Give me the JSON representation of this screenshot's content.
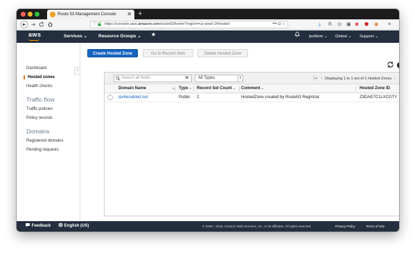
{
  "browser": {
    "tab_title": "Route 53 Management Console",
    "tab_close": "✕",
    "new_tab": "+",
    "url_prefix": "https://console.aws.",
    "url_domain": "amazon.com",
    "url_rest": "/route53/home?region=us-west-1#hosted",
    "url_tools": "•••  ◘  ☆"
  },
  "aws_header": {
    "logo": "aws",
    "services": "Services ⌄",
    "resource_groups": "Resource Groups ⌄",
    "pin_icon": "pin-icon",
    "bell_icon": "bell-icon",
    "account": "ipv6tom ⌄",
    "region": "Global ⌄",
    "support": "Support ⌄"
  },
  "sidebar": {
    "collapse": "‹",
    "items": [
      {
        "label": "Dashboard"
      },
      {
        "label": "Hosted zones"
      },
      {
        "label": "Health checks"
      },
      {
        "label": "Traffic flow"
      },
      {
        "label": "Traffic policies"
      },
      {
        "label": "Policy records"
      },
      {
        "label": "Domains"
      },
      {
        "label": "Registered domains"
      },
      {
        "label": "Pending requests"
      }
    ]
  },
  "toolbar": {
    "create_label": "Create Hosted Zone",
    "goto_label": "Go to Record Sets",
    "delete_label": "Delete Hosted Zone"
  },
  "filter": {
    "search_placeholder": "Search all fields",
    "type_value": "All Types",
    "pager_text": "Displaying 1 to 1 out of 1 Hosted Zones"
  },
  "table": {
    "columns": [
      "Domain Name",
      "Type",
      "Record Set Count",
      "Comment",
      "Hosted Zone ID"
    ],
    "rows": [
      {
        "domain": "ipv6enabled.net.",
        "type": "Public",
        "count": "2",
        "comment": "HostedZone created by Route53 Registrar",
        "zone_id": "Z3DAE7C1LXCGTY"
      }
    ]
  },
  "footer": {
    "feedback": "Feedback",
    "language": "English (US)",
    "copyright": "© 2008 - 2018, Amazon Web Services, Inc. or its affiliates. All rights reserved.",
    "privacy": "Privacy Policy",
    "terms": "Terms of Use"
  },
  "colors": {
    "aws_navy": "#232f3e",
    "aws_orange": "#ff9900",
    "primary_blue": "#1565c0"
  }
}
